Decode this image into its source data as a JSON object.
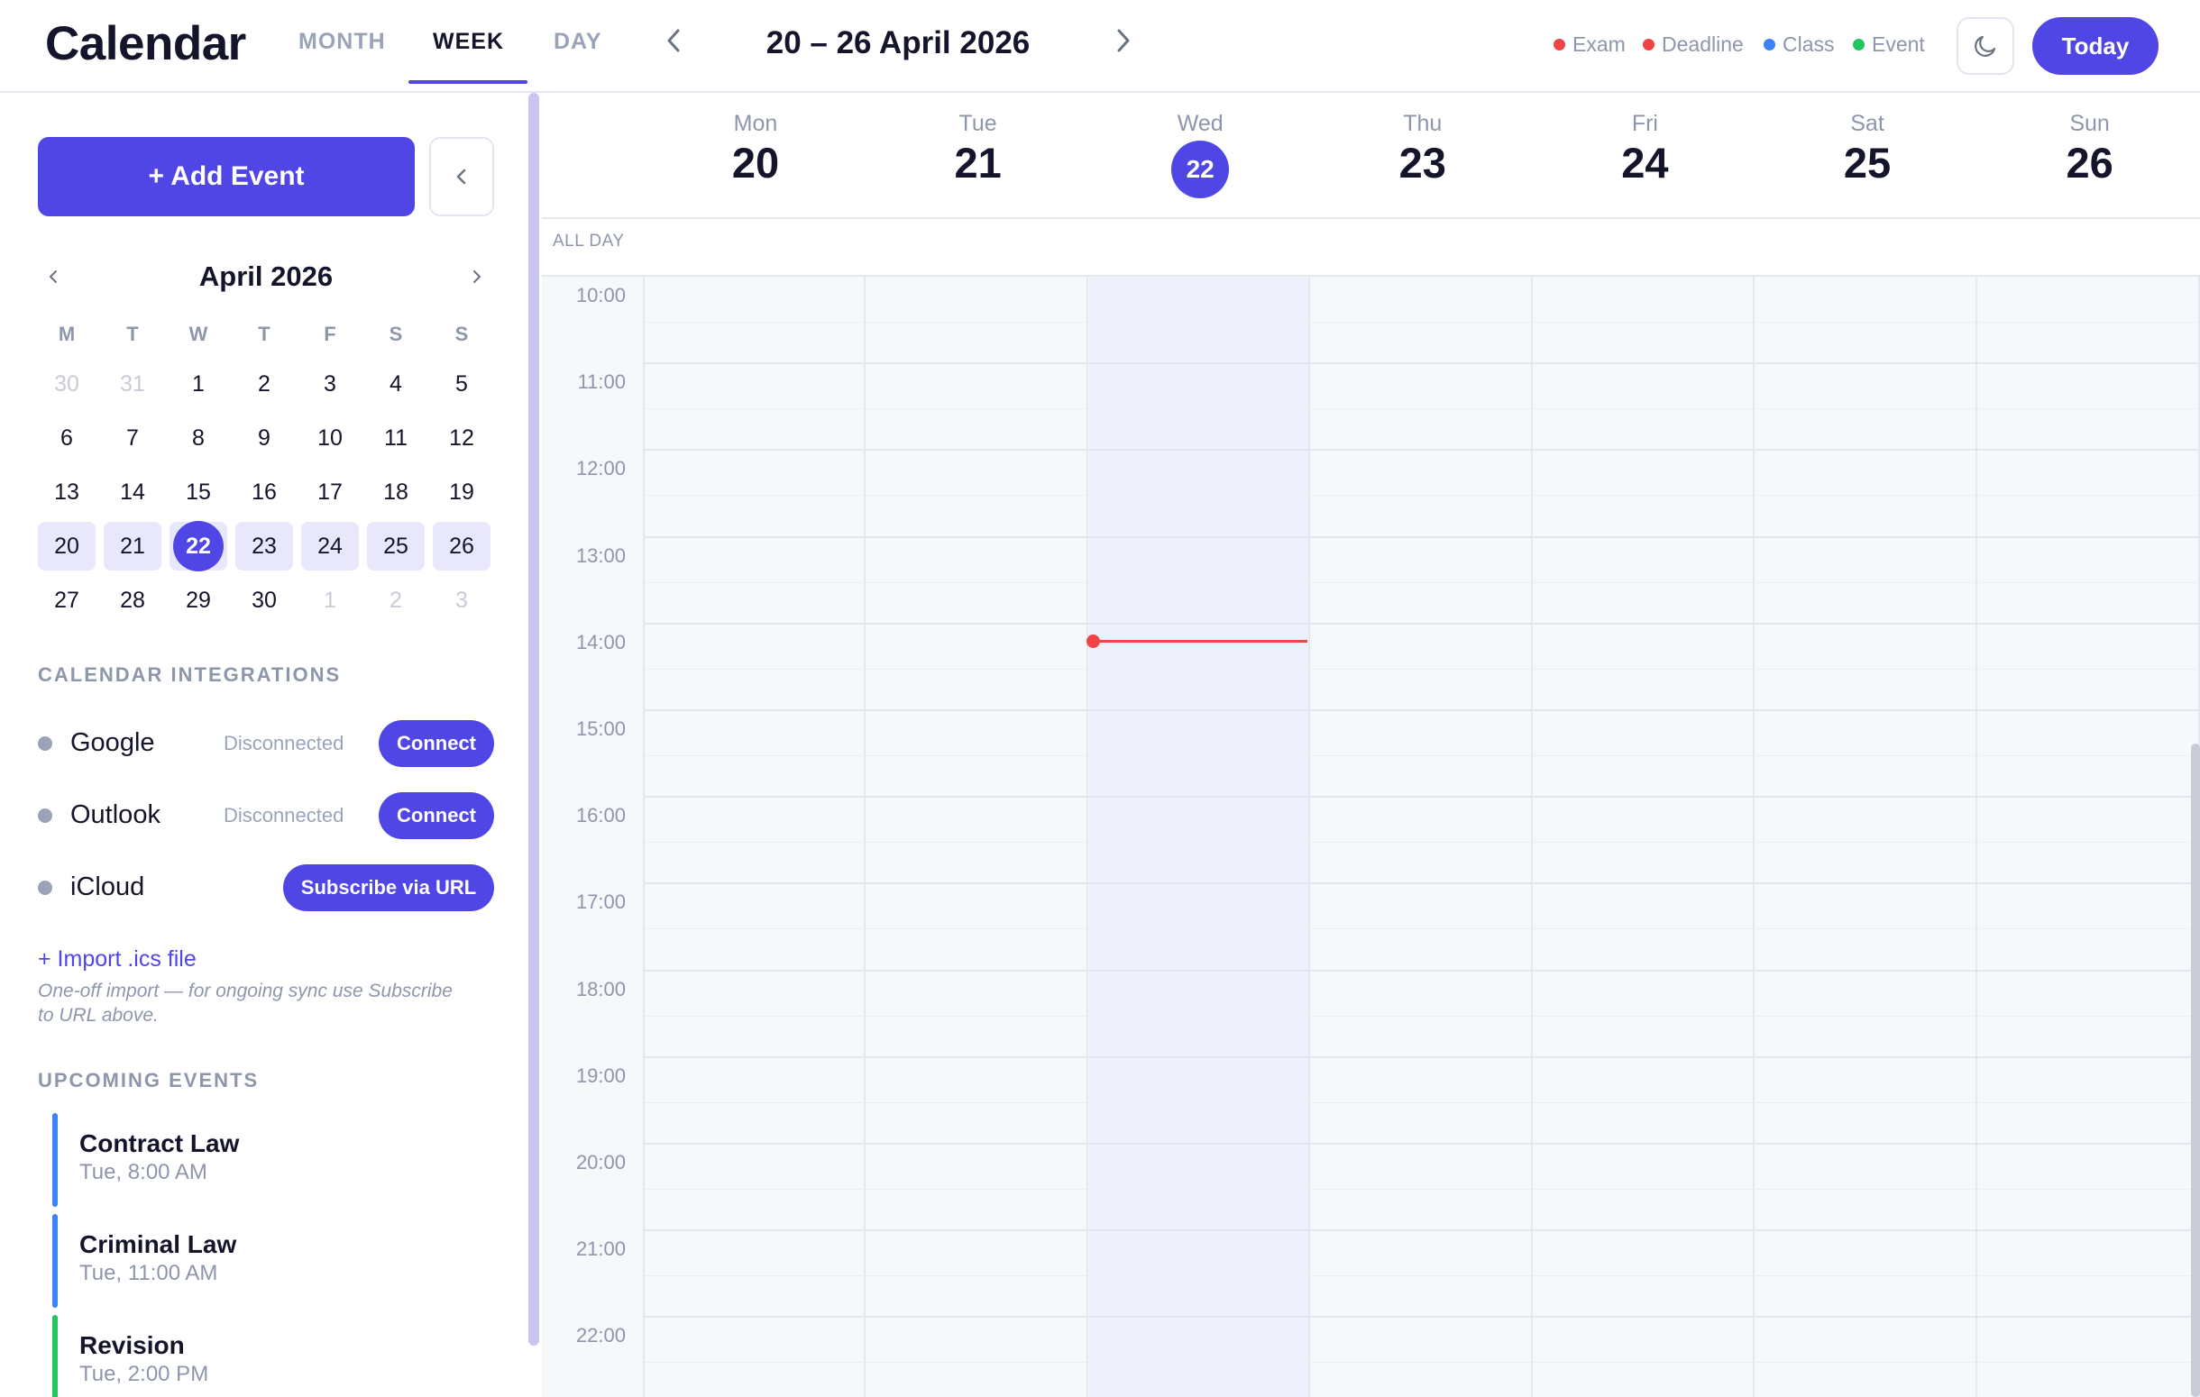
{
  "header": {
    "title": "Calendar",
    "tabs": [
      "MONTH",
      "WEEK",
      "DAY"
    ],
    "active_tab": "WEEK",
    "range": "20 – 26 April 2026",
    "legend": [
      {
        "label": "Exam",
        "color": "#ef4444"
      },
      {
        "label": "Deadline",
        "color": "#ef4444"
      },
      {
        "label": "Class",
        "color": "#3b82f6"
      },
      {
        "label": "Event",
        "color": "#22c55e"
      }
    ],
    "theme_icon": "moon-icon",
    "today_label": "Today"
  },
  "sidebar": {
    "add_event_label": "+ Add Event",
    "collapse_icon": "chevron-left-icon",
    "mini_calendar": {
      "month": "April 2026",
      "weekdays": [
        "M",
        "T",
        "W",
        "T",
        "F",
        "S",
        "S"
      ],
      "days": [
        {
          "d": "30",
          "muted": true
        },
        {
          "d": "31",
          "muted": true
        },
        {
          "d": "1"
        },
        {
          "d": "2"
        },
        {
          "d": "3"
        },
        {
          "d": "4"
        },
        {
          "d": "5"
        },
        {
          "d": "6"
        },
        {
          "d": "7"
        },
        {
          "d": "8"
        },
        {
          "d": "9"
        },
        {
          "d": "10"
        },
        {
          "d": "11"
        },
        {
          "d": "12"
        },
        {
          "d": "13"
        },
        {
          "d": "14"
        },
        {
          "d": "15"
        },
        {
          "d": "16"
        },
        {
          "d": "17"
        },
        {
          "d": "18"
        },
        {
          "d": "19"
        },
        {
          "d": "20",
          "week": true
        },
        {
          "d": "21",
          "week": true
        },
        {
          "d": "22",
          "week": true,
          "today": true
        },
        {
          "d": "23",
          "week": true
        },
        {
          "d": "24",
          "week": true
        },
        {
          "d": "25",
          "week": true
        },
        {
          "d": "26",
          "week": true
        },
        {
          "d": "27"
        },
        {
          "d": "28"
        },
        {
          "d": "29"
        },
        {
          "d": "30"
        },
        {
          "d": "1",
          "muted": true
        },
        {
          "d": "2",
          "muted": true
        },
        {
          "d": "3",
          "muted": true
        }
      ]
    },
    "integrations_title": "CALENDAR INTEGRATIONS",
    "integrations": [
      {
        "name": "Google",
        "status": "Disconnected",
        "button": "Connect"
      },
      {
        "name": "Outlook",
        "status": "Disconnected",
        "button": "Connect"
      },
      {
        "name": "iCloud",
        "status": "",
        "button": "Subscribe via URL"
      }
    ],
    "import_label": "+ Import .ics file",
    "import_hint": "One-off import — for ongoing sync use Subscribe to URL above.",
    "upcoming_title": "UPCOMING EVENTS",
    "upcoming": [
      {
        "title": "Contract Law",
        "time": "Tue, 8:00 AM",
        "color": "#3b82f6"
      },
      {
        "title": "Criminal Law",
        "time": "Tue, 11:00 AM",
        "color": "#3b82f6"
      },
      {
        "title": "Revision",
        "time": "Tue, 2:00 PM",
        "color": "#22c55e"
      }
    ]
  },
  "week": {
    "days": [
      {
        "name": "Mon",
        "num": "20"
      },
      {
        "name": "Tue",
        "num": "21"
      },
      {
        "name": "Wed",
        "num": "22",
        "today": true
      },
      {
        "name": "Thu",
        "num": "23"
      },
      {
        "name": "Fri",
        "num": "24"
      },
      {
        "name": "Sat",
        "num": "25"
      },
      {
        "name": "Sun",
        "num": "26"
      }
    ],
    "all_day_label": "ALL DAY",
    "hours": [
      "10:00",
      "11:00",
      "12:00",
      "13:00",
      "14:00",
      "15:00",
      "16:00",
      "17:00",
      "18:00",
      "19:00",
      "20:00",
      "21:00",
      "22:00"
    ],
    "current_time_indicator": "now-line"
  }
}
